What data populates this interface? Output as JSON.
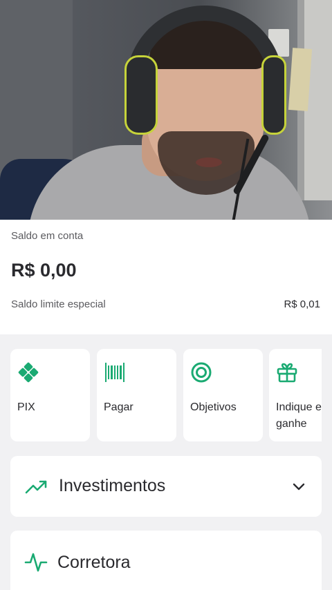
{
  "balance": {
    "label": "Saldo em conta",
    "amount": "R$ 0,00",
    "limit_label": "Saldo limite especial",
    "limit_value": "R$ 0,01"
  },
  "shortcuts": [
    {
      "label": "PIX",
      "icon": "pix-icon"
    },
    {
      "label": "Pagar",
      "icon": "barcode-icon"
    },
    {
      "label": "Objetivos",
      "icon": "target-icon"
    },
    {
      "label": "Indique e",
      "label_line2": "ganhe",
      "icon": "gift-icon"
    }
  ],
  "sections": [
    {
      "title": "Investimentos",
      "icon": "trending-up-icon",
      "expand_icon": "chevron-down-icon"
    },
    {
      "title": "Corretora",
      "icon": "activity-pulse-icon"
    }
  ],
  "colors": {
    "accent": "#1aaa72",
    "background": "#f1f1f3",
    "card": "#ffffff",
    "text_primary": "#2a2a2e",
    "text_secondary": "#5a5a5e"
  }
}
